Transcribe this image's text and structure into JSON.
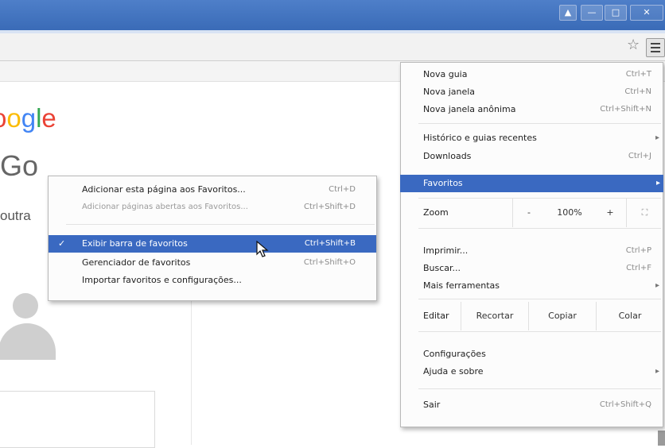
{
  "window": {
    "controls": [
      "▲",
      "—",
      "□",
      "✕"
    ]
  },
  "page": {
    "logo_letters": [
      {
        "t": "o",
        "c": "#ea4335"
      },
      {
        "t": "o",
        "c": "#fbbc05"
      },
      {
        "t": "g",
        "c": "#4285f4"
      },
      {
        "t": "l",
        "c": "#34a853"
      },
      {
        "t": "e",
        "c": "#ea4335"
      }
    ],
    "title_fragment": "Go",
    "side_text": "outra"
  },
  "main_menu": {
    "items": {
      "nova_guia": {
        "label": "Nova guia",
        "shortcut": "Ctrl+T"
      },
      "nova_janela": {
        "label": "Nova janela",
        "shortcut": "Ctrl+N"
      },
      "anonima": {
        "label": "Nova janela anônima",
        "shortcut": "Ctrl+Shift+N"
      },
      "historico": {
        "label": "Histórico e guias recentes",
        "arrow": "▸"
      },
      "downloads": {
        "label": "Downloads",
        "shortcut": "Ctrl+J"
      },
      "favoritos": {
        "label": "Favoritos",
        "arrow": "▸"
      },
      "zoom": {
        "label": "Zoom",
        "minus": "-",
        "value": "100%",
        "plus": "+",
        "fullscreen": "⛶"
      },
      "imprimir": {
        "label": "Imprimir...",
        "shortcut": "Ctrl+P"
      },
      "buscar": {
        "label": "Buscar...",
        "shortcut": "Ctrl+F"
      },
      "ferramentas": {
        "label": "Mais ferramentas",
        "arrow": "▸"
      },
      "editar": {
        "label": "Editar",
        "recortar": "Recortar",
        "copiar": "Copiar",
        "colar": "Colar"
      },
      "config": {
        "label": "Configurações"
      },
      "ajuda": {
        "label": "Ajuda e sobre",
        "arrow": "▸"
      },
      "sair": {
        "label": "Sair",
        "shortcut": "Ctrl+Shift+Q"
      }
    }
  },
  "bookmarks_menu": {
    "items": {
      "add_page": {
        "label": "Adicionar esta página aos Favoritos...",
        "shortcut": "Ctrl+D"
      },
      "add_open": {
        "label": "Adicionar páginas abertas aos Favoritos...",
        "shortcut": "Ctrl+Shift+D"
      },
      "show_bar": {
        "label": "Exibir barra de favoritos",
        "shortcut": "Ctrl+Shift+B",
        "check": "✓"
      },
      "manager": {
        "label": "Gerenciador de favoritos",
        "shortcut": "Ctrl+Shift+O"
      },
      "import": {
        "label": "Importar favoritos e configurações..."
      }
    }
  }
}
